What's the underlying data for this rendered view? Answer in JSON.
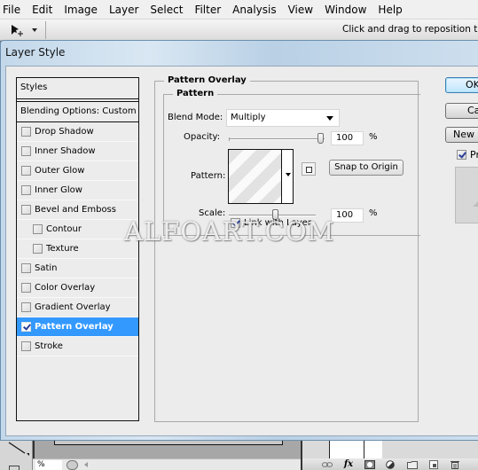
{
  "menubar": {
    "items": [
      "File",
      "Edit",
      "Image",
      "Layer",
      "Select",
      "Filter",
      "Analysis",
      "View",
      "Window",
      "Help"
    ]
  },
  "options_bar": {
    "tool_icon": "path-selection-icon",
    "hint": "Click and drag to reposition the pattern."
  },
  "dialog": {
    "title": "Layer Style",
    "styles_list": {
      "header": "Styles",
      "blending_options": "Blending Options: Custom",
      "items": [
        {
          "label": "Drop Shadow",
          "checked": false,
          "indent": false,
          "selected": false
        },
        {
          "label": "Inner Shadow",
          "checked": false,
          "indent": false,
          "selected": false
        },
        {
          "label": "Outer Glow",
          "checked": false,
          "indent": false,
          "selected": false
        },
        {
          "label": "Inner Glow",
          "checked": false,
          "indent": false,
          "selected": false
        },
        {
          "label": "Bevel and Emboss",
          "checked": false,
          "indent": false,
          "selected": false
        },
        {
          "label": "Contour",
          "checked": false,
          "indent": true,
          "selected": false
        },
        {
          "label": "Texture",
          "checked": false,
          "indent": true,
          "selected": false
        },
        {
          "label": "Satin",
          "checked": false,
          "indent": false,
          "selected": false
        },
        {
          "label": "Color Overlay",
          "checked": false,
          "indent": false,
          "selected": false
        },
        {
          "label": "Gradient Overlay",
          "checked": false,
          "indent": false,
          "selected": false
        },
        {
          "label": "Pattern Overlay",
          "checked": true,
          "indent": false,
          "selected": true
        },
        {
          "label": "Stroke",
          "checked": false,
          "indent": false,
          "selected": false
        }
      ]
    },
    "pattern_overlay": {
      "section_title": "Pattern Overlay",
      "group_title": "Pattern",
      "blend_mode_label": "Blend Mode:",
      "blend_mode_value": "Multiply",
      "opacity_label": "Opacity:",
      "opacity_value": "100",
      "opacity_percent": 100,
      "opacity_unit": "%",
      "pattern_label": "Pattern:",
      "snap_button": "Snap to Origin",
      "scale_label": "Scale:",
      "scale_value": "100",
      "scale_percent": 100,
      "scale_unit": "%",
      "link_label": "Link with Layer",
      "link_checked": true
    },
    "buttons": {
      "ok": "OK",
      "cancel": "Cancel",
      "new_style": "New Style...",
      "preview_label": "Preview",
      "preview_checked": true
    }
  },
  "watermark": "ALFOART.COM",
  "statusbar": {
    "zoom_value": "%"
  },
  "layers_panel": {
    "icons": [
      "link-layers-icon",
      "fx-icon",
      "layer-mask-icon",
      "adjustment-layer-icon",
      "new-group-icon",
      "new-layer-icon",
      "trash-icon"
    ],
    "fx_label": "fx"
  }
}
